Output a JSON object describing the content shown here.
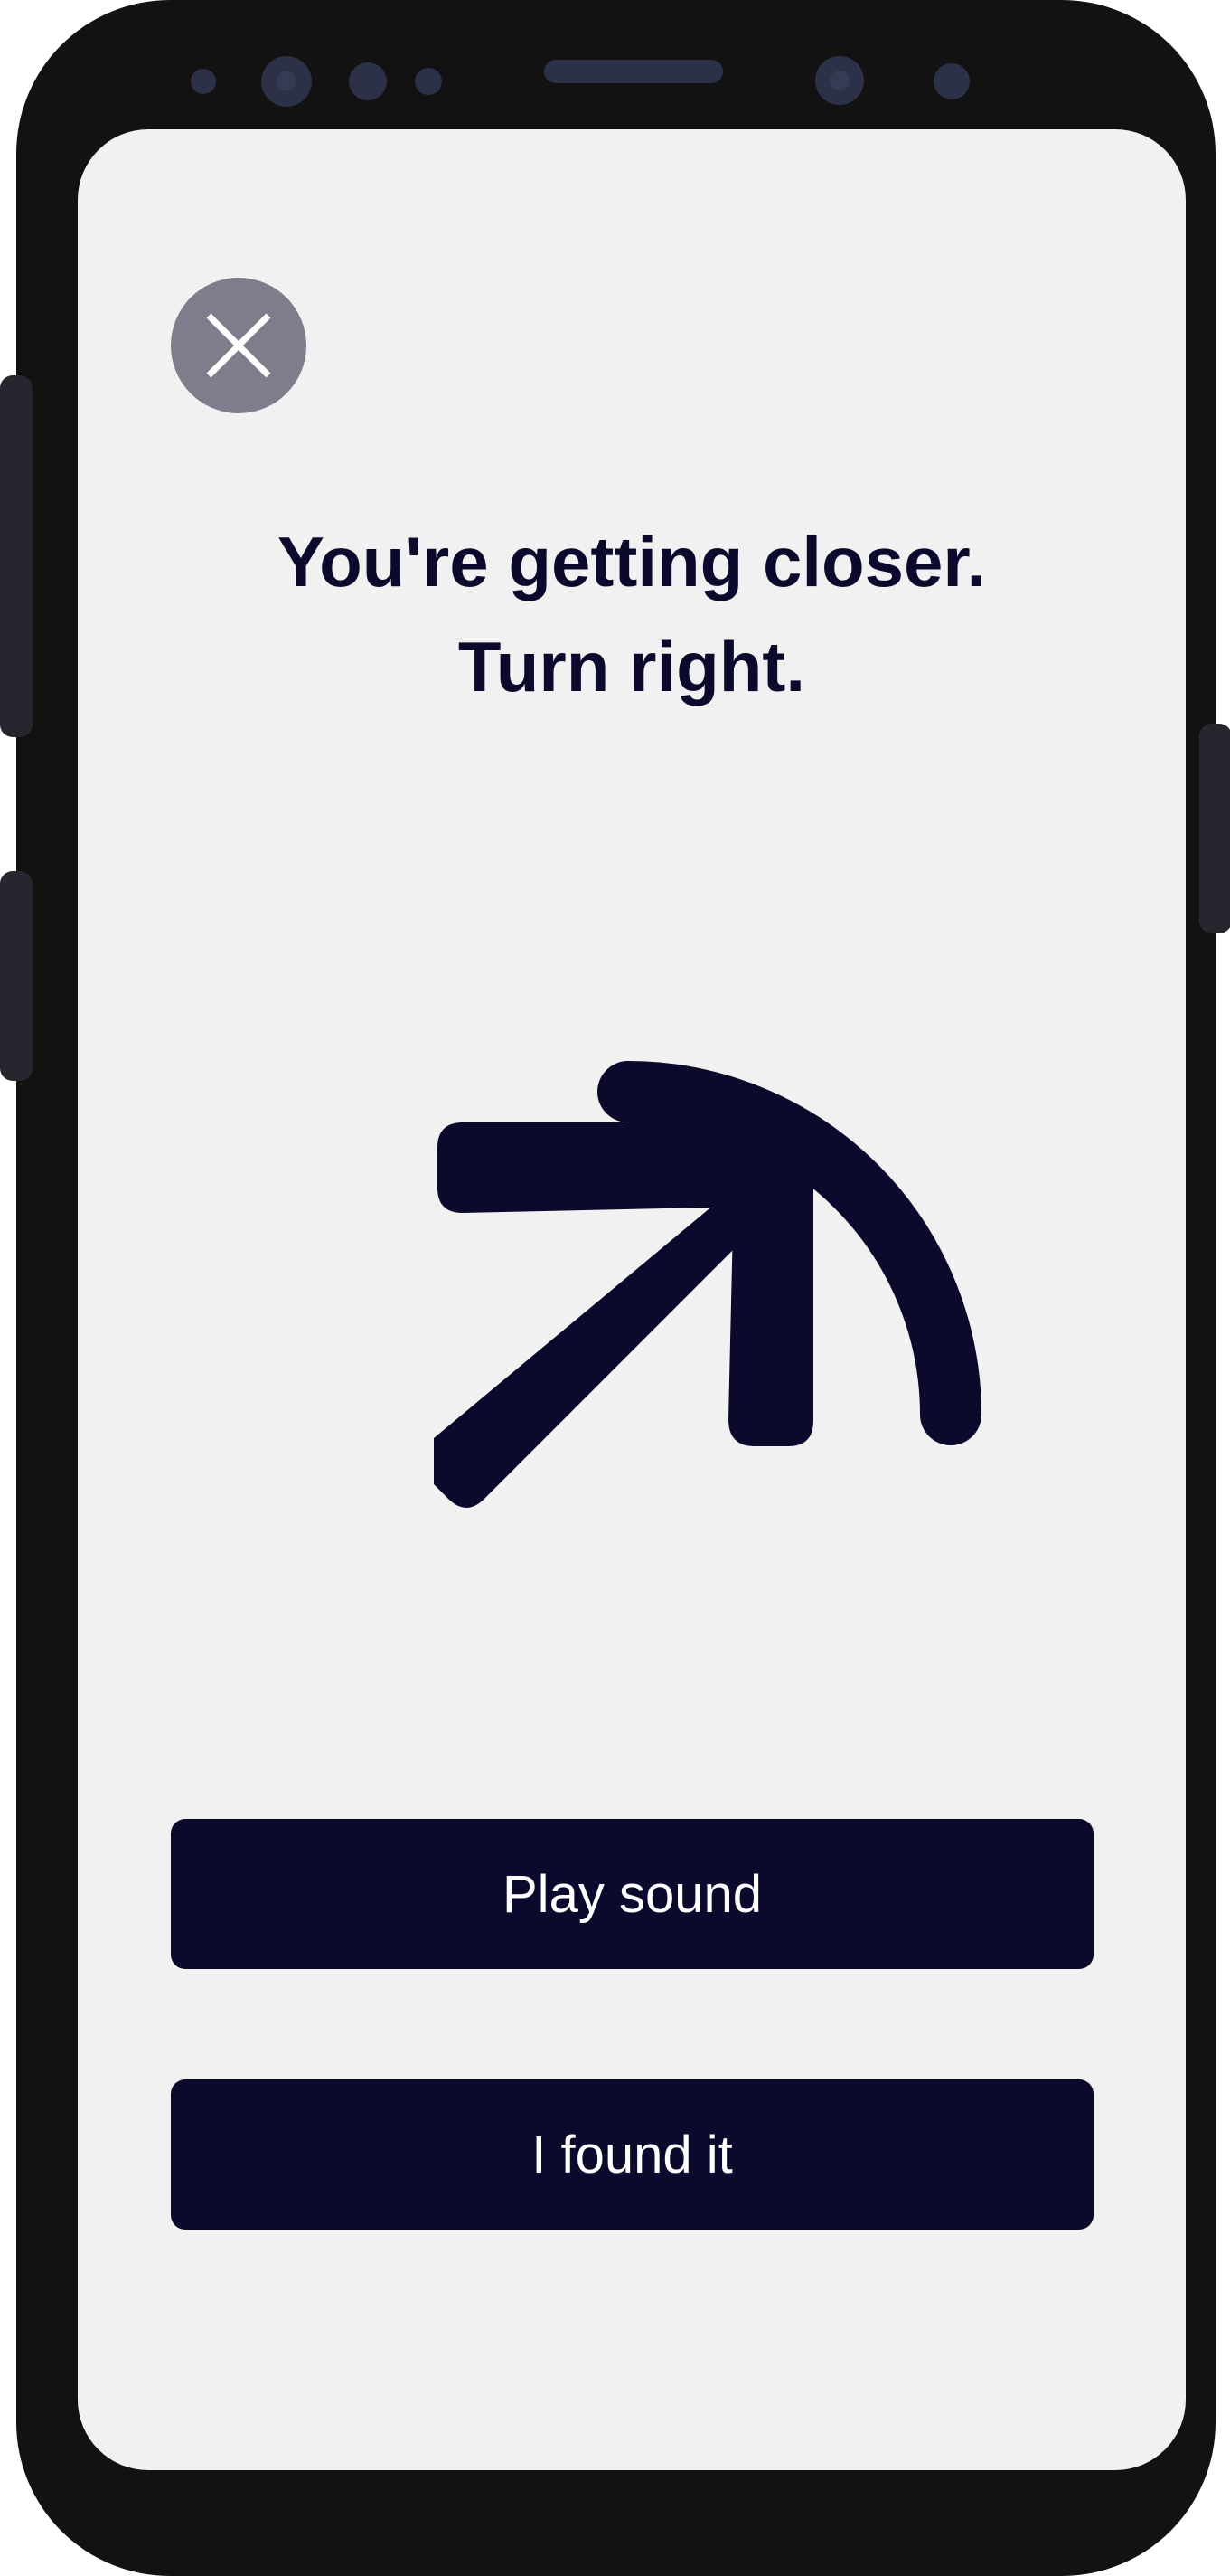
{
  "screen": {
    "title_line1": "You're getting closer.",
    "title_line2": "Turn right.",
    "close_icon": "close-icon",
    "direction_icon": "turn-right-arrow-icon"
  },
  "actions": {
    "play_sound_label": "Play sound",
    "found_it_label": "I found it"
  },
  "colors": {
    "primary": "#0b0a2d",
    "close_button": "#7e7d8c",
    "background": "#f1f1f1",
    "device": "#121212"
  }
}
